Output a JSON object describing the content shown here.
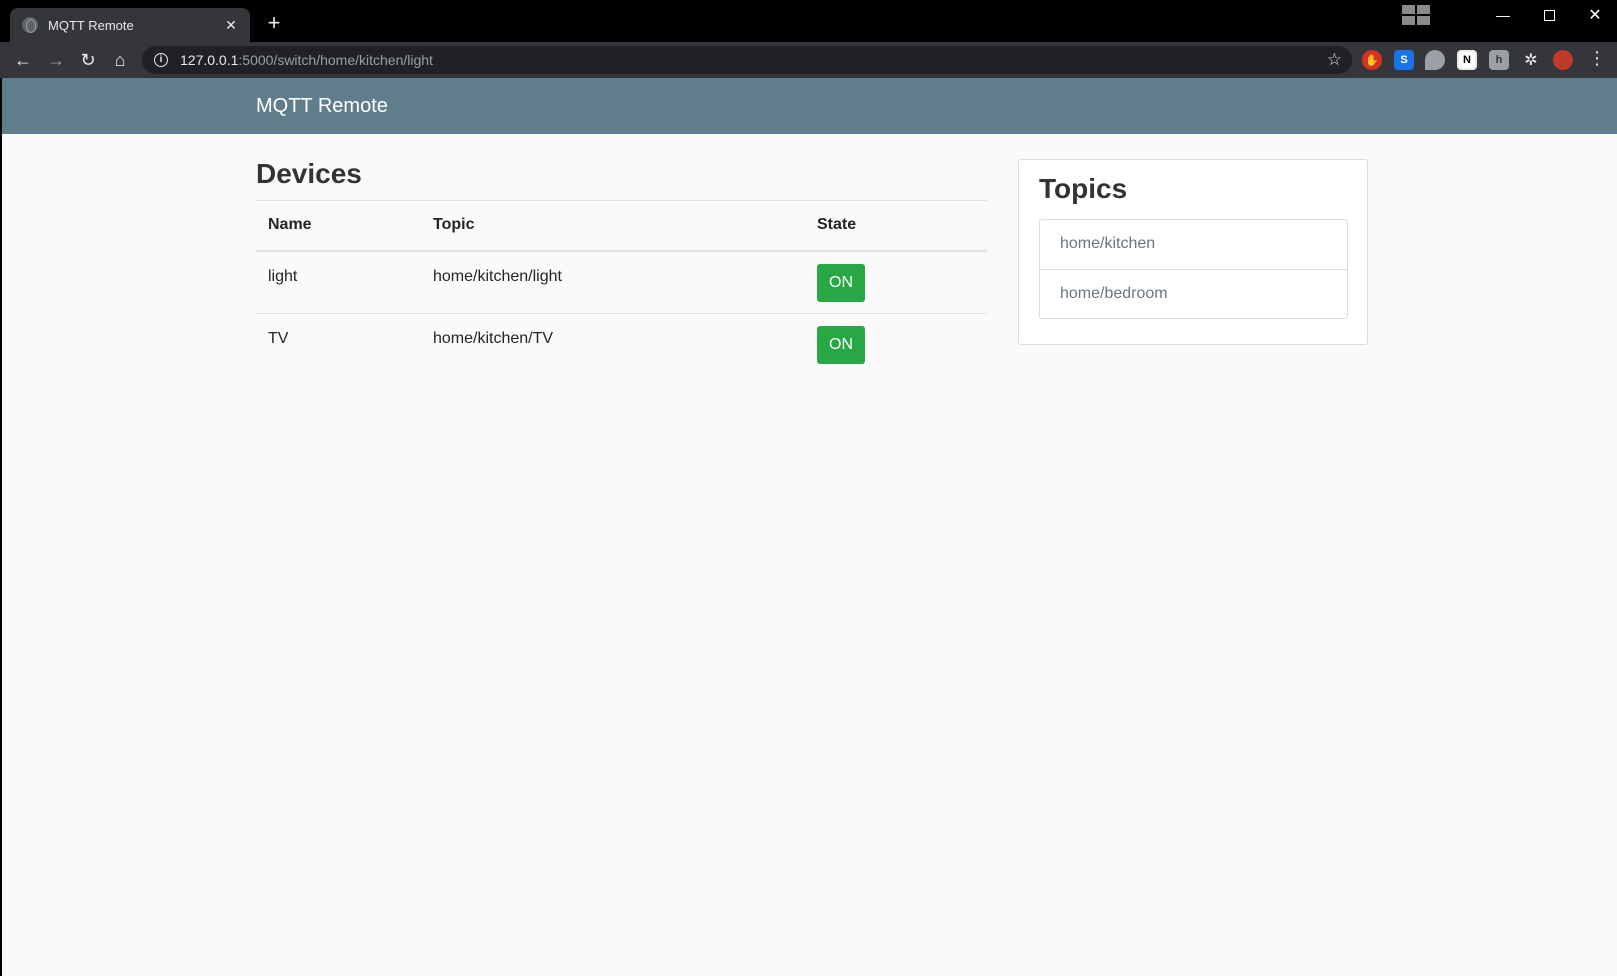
{
  "browser": {
    "tab_title": "MQTT Remote",
    "tab_close": "✕",
    "new_tab": "+",
    "url_host": "127.0.0.1",
    "url_path": ":5000/switch/home/kitchen/light"
  },
  "navbar": {
    "brand": "MQTT Remote",
    "color": "#607d8b"
  },
  "devices": {
    "title": "Devices",
    "headers": [
      "Name",
      "Topic",
      "State"
    ],
    "rows": [
      {
        "name": "light",
        "topic": "home/kitchen/light",
        "state": "ON"
      },
      {
        "name": "TV",
        "topic": "home/kitchen/TV",
        "state": "ON"
      }
    ],
    "state_color": "#28a745"
  },
  "topics": {
    "title": "Topics",
    "items": [
      "home/kitchen",
      "home/bedroom"
    ]
  }
}
